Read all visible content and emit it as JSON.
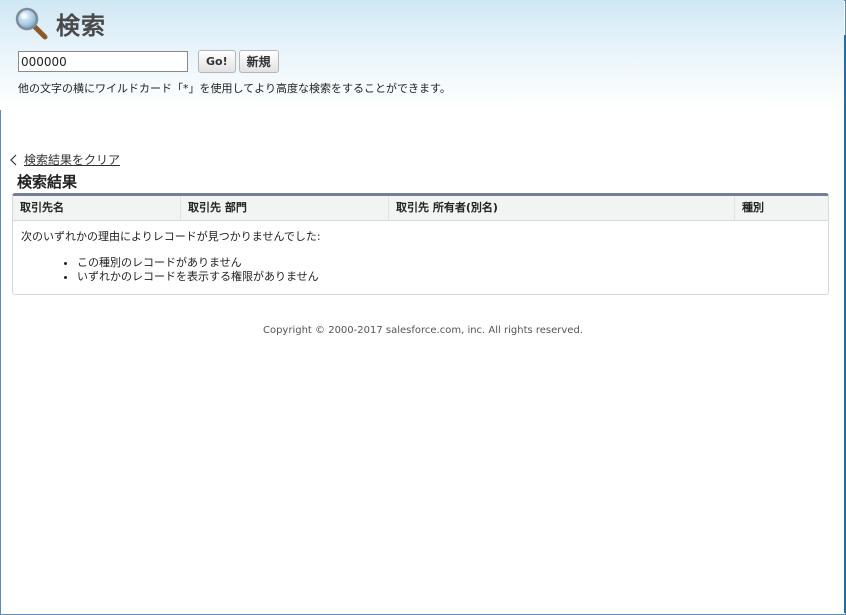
{
  "page": {
    "title": "検索",
    "title_icon": "search-icon"
  },
  "search": {
    "value": "000000",
    "go_label": "Go!",
    "new_label": "新規",
    "hint": "他の文字の横にワイルドカード「*」を使用してより高度な検索をすることができます。"
  },
  "results": {
    "clear_link": "検索結果をクリア",
    "section_title": "検索結果",
    "columns": [
      "取引先名",
      "取引先 部門",
      "取引先 所有者(別名)",
      "種別"
    ],
    "no_records_message": "次のいずれかの理由によりレコードが見つかりませんでした:",
    "reasons": [
      "この種別のレコードがありません",
      "いずれかのレコードを表示する権限がありません"
    ]
  },
  "footer": {
    "copyright": "Copyright © 2000-2017 salesforce.com, inc. All rights reserved."
  },
  "colors": {
    "header_gradient_top": "#cfe7f4",
    "frame_border": "#5b8fbf",
    "table_top_border": "#747e96",
    "table_header_bg": "#f2f3f3"
  }
}
